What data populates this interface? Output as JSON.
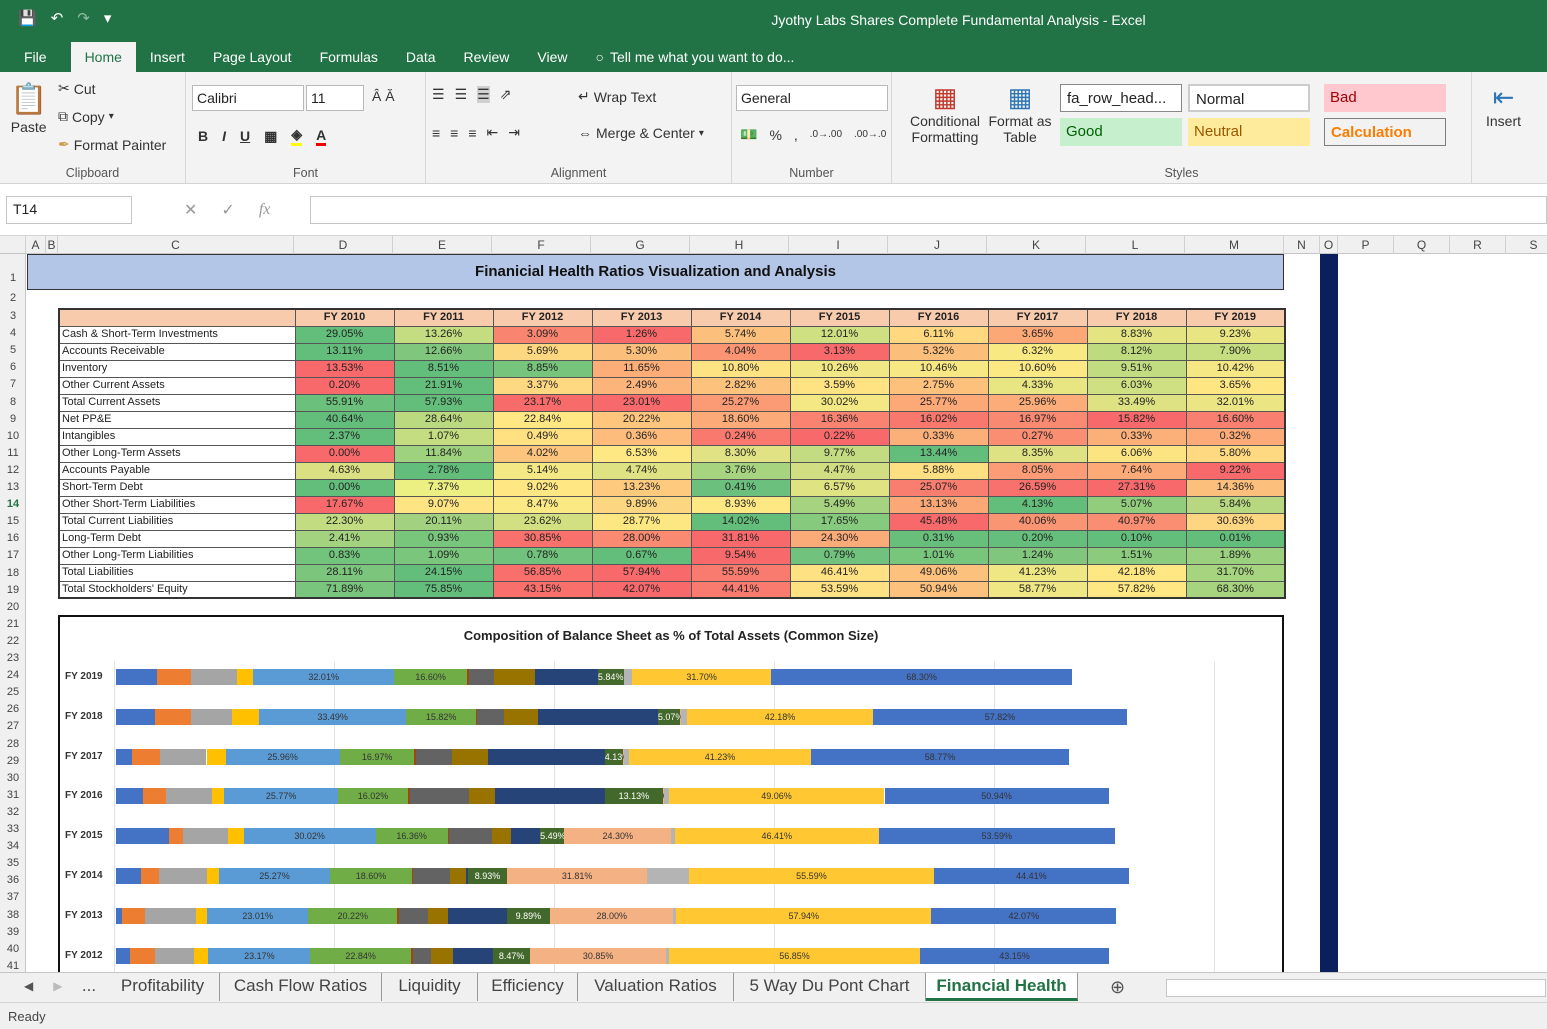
{
  "window_title": "Jyothy Labs Shares Complete Fundamental Analysis - Excel",
  "ribbon_tabs": [
    "File",
    "Home",
    "Insert",
    "Page Layout",
    "Formulas",
    "Data",
    "Review",
    "View"
  ],
  "tell_me": "Tell me what you want to do...",
  "clipboard": {
    "paste": "Paste",
    "cut": "Cut",
    "copy": "Copy",
    "format_painter": "Format Painter",
    "label": "Clipboard"
  },
  "font": {
    "name": "Calibri",
    "size": "11",
    "label": "Font"
  },
  "alignment": {
    "wrap": "Wrap Text",
    "merge": "Merge & Center",
    "label": "Alignment"
  },
  "number": {
    "format": "General",
    "label": "Number"
  },
  "styles": {
    "conditional": "Conditional Formatting",
    "format_table": "Format as Table",
    "label": "Styles",
    "cells": [
      "fa_row_head...",
      "Normal",
      "Bad",
      "Good",
      "Neutral",
      "Calculation"
    ]
  },
  "cells_group": {
    "insert": "Insert"
  },
  "name_box": "T14",
  "columns": [
    "A",
    "B",
    "C",
    "D",
    "E",
    "F",
    "G",
    "H",
    "I",
    "J",
    "K",
    "L",
    "M",
    "N",
    "O",
    "P",
    "Q",
    "R",
    "S"
  ],
  "rows": [
    "1",
    "2",
    "3",
    "4",
    "5",
    "6",
    "7",
    "8",
    "9",
    "10",
    "11",
    "12",
    "13",
    "14",
    "15",
    "16",
    "17",
    "18",
    "19",
    "20",
    "21",
    "22",
    "23",
    "24",
    "25",
    "26",
    "27",
    "28",
    "29",
    "30",
    "31",
    "32",
    "33",
    "34",
    "35",
    "36",
    "37",
    "38",
    "39",
    "40",
    "41"
  ],
  "sheet_title": "Finanicial Health Ratios Visualization and Analysis",
  "table": {
    "years": [
      "FY 2010",
      "FY 2011",
      "FY 2012",
      "FY 2013",
      "FY 2014",
      "FY 2015",
      "FY 2016",
      "FY 2017",
      "FY 2018",
      "FY 2019"
    ],
    "rows": [
      {
        "label": "Cash & Short-Term Investments",
        "values": [
          "29.05%",
          "13.26%",
          "3.09%",
          "1.26%",
          "5.74%",
          "12.01%",
          "6.11%",
          "3.65%",
          "8.83%",
          "9.23%"
        ],
        "colors": [
          "#63be7b",
          "#c3dd80",
          "#f98470",
          "#f8696b",
          "#fdc07c",
          "#cfe082",
          "#ffd880",
          "#fba776",
          "#e4e483",
          "#e9e583"
        ]
      },
      {
        "label": "Accounts Receivable",
        "values": [
          "13.11%",
          "12.66%",
          "5.69%",
          "5.30%",
          "4.04%",
          "3.13%",
          "5.32%",
          "6.32%",
          "8.12%",
          "7.90%"
        ],
        "colors": [
          "#63be7b",
          "#80c77d",
          "#fed880",
          "#fcbe7b",
          "#fa9473",
          "#f8696b",
          "#fcbf7b",
          "#f8e983",
          "#bfdb7f",
          "#c7de80"
        ]
      },
      {
        "label": "Inventory",
        "values": [
          "13.53%",
          "8.51%",
          "8.85%",
          "11.65%",
          "10.80%",
          "10.26%",
          "10.46%",
          "10.60%",
          "9.51%",
          "10.42%"
        ],
        "colors": [
          "#f8696b",
          "#63be7b",
          "#77c47c",
          "#fcad78",
          "#fee382",
          "#f1e784",
          "#f7e883",
          "#fde983",
          "#c2dc81",
          "#f5e884"
        ]
      },
      {
        "label": "Other Current Assets",
        "values": [
          "0.20%",
          "21.91%",
          "3.37%",
          "2.49%",
          "2.82%",
          "3.59%",
          "2.75%",
          "4.33%",
          "6.03%",
          "3.65%"
        ],
        "colors": [
          "#f8696b",
          "#63be7b",
          "#ffd981",
          "#fcb47a",
          "#fdc37d",
          "#ffe383",
          "#fdc17c",
          "#e8e583",
          "#cfe082",
          "#fee683"
        ]
      },
      {
        "label": "Total Current Assets",
        "values": [
          "55.91%",
          "57.93%",
          "23.17%",
          "23.01%",
          "25.27%",
          "30.02%",
          "25.77%",
          "25.96%",
          "33.49%",
          "32.01%"
        ],
        "colors": [
          "#6bc07b",
          "#63be7b",
          "#f86b6b",
          "#f8696b",
          "#fb9b75",
          "#f3e884",
          "#fca877",
          "#fcac78",
          "#dee283",
          "#ebe583"
        ]
      },
      {
        "label": "Net PP&E",
        "values": [
          "40.64%",
          "28.64%",
          "22.84%",
          "20.22%",
          "18.60%",
          "16.36%",
          "16.02%",
          "16.97%",
          "15.82%",
          "16.60%"
        ],
        "colors": [
          "#63be7b",
          "#bbda80",
          "#ffe883",
          "#fec57d",
          "#fcab78",
          "#f98270",
          "#f8786e",
          "#fa8972",
          "#f8696b",
          "#f97f70"
        ]
      },
      {
        "label": "Intangibles",
        "values": [
          "2.37%",
          "1.07%",
          "0.49%",
          "0.36%",
          "0.24%",
          "0.22%",
          "0.33%",
          "0.27%",
          "0.33%",
          "0.32%"
        ],
        "colors": [
          "#63be7b",
          "#c4dd80",
          "#ffe182",
          "#fdbc7b",
          "#f9796e",
          "#f8696b",
          "#fbaf79",
          "#fa8e72",
          "#fbaf79",
          "#fbaa78"
        ]
      },
      {
        "label": "Other Long-Term Assets",
        "values": [
          "0.00%",
          "11.84%",
          "4.02%",
          "6.53%",
          "8.30%",
          "9.77%",
          "13.44%",
          "8.35%",
          "6.06%",
          "5.80%"
        ],
        "colors": [
          "#f8696b",
          "#9fd27f",
          "#fdc47d",
          "#fee883",
          "#e0e283",
          "#c3dc81",
          "#63be7b",
          "#dfe282",
          "#fde483",
          "#fed981"
        ]
      },
      {
        "label": "Accounts Payable",
        "values": [
          "4.63%",
          "2.78%",
          "5.14%",
          "4.74%",
          "3.76%",
          "4.47%",
          "5.88%",
          "8.05%",
          "7.64%",
          "9.22%"
        ],
        "colors": [
          "#dbe182",
          "#63be7b",
          "#f3e884",
          "#dfe282",
          "#a6d47f",
          "#d1de81",
          "#fedf81",
          "#fb9c76",
          "#fcab78",
          "#f8696b"
        ]
      },
      {
        "label": "Short-Term Debt",
        "values": [
          "0.00%",
          "7.37%",
          "9.02%",
          "13.23%",
          "0.41%",
          "6.57%",
          "25.07%",
          "26.59%",
          "27.31%",
          "14.36%"
        ],
        "colors": [
          "#63be7b",
          "#ecf083",
          "#ffe883",
          "#feca7e",
          "#6ac07c",
          "#dfe382",
          "#f97e6f",
          "#f8716c",
          "#f8696b",
          "#fdbf7c"
        ]
      },
      {
        "label": "Other Short-Term Liabilities",
        "values": [
          "17.67%",
          "9.07%",
          "8.47%",
          "9.89%",
          "8.93%",
          "5.49%",
          "13.13%",
          "4.13%",
          "5.07%",
          "5.84%"
        ],
        "colors": [
          "#f8696b",
          "#fee483",
          "#fbe983",
          "#fcd680",
          "#fde883",
          "#a5d37f",
          "#fba776",
          "#63be7b",
          "#92cd7e",
          "#b7d880"
        ]
      },
      {
        "label": "Total Current Liabilities",
        "values": [
          "22.30%",
          "20.11%",
          "23.62%",
          "28.77%",
          "14.02%",
          "17.65%",
          "45.48%",
          "40.06%",
          "40.97%",
          "30.63%"
        ],
        "colors": [
          "#c1dc81",
          "#a2d27f",
          "#d3e082",
          "#fde783",
          "#63be7b",
          "#86ca7d",
          "#f8696b",
          "#fa9573",
          "#fa8e72",
          "#fed581"
        ]
      },
      {
        "label": "Long-Term Debt",
        "values": [
          "2.41%",
          "0.93%",
          "30.85%",
          "28.00%",
          "31.81%",
          "24.30%",
          "0.31%",
          "0.20%",
          "0.10%",
          "0.01%"
        ],
        "colors": [
          "#a3d37f",
          "#78c57c",
          "#f8716c",
          "#fa8b72",
          "#f8696b",
          "#fbab78",
          "#67bf7b",
          "#65be7b",
          "#64be7b",
          "#63be7b"
        ]
      },
      {
        "label": "Other Long-Term Liabilities",
        "values": [
          "0.83%",
          "1.09%",
          "0.78%",
          "0.67%",
          "9.54%",
          "0.79%",
          "1.01%",
          "1.24%",
          "1.51%",
          "1.89%"
        ],
        "colors": [
          "#72c37c",
          "#7ac67c",
          "#70c27c",
          "#63be7b",
          "#f8696b",
          "#70c27c",
          "#78c57c",
          "#80c77d",
          "#8bcb7e",
          "#9ad07e"
        ]
      },
      {
        "label": "Total Liabilities",
        "values": [
          "28.11%",
          "24.15%",
          "56.85%",
          "57.94%",
          "55.59%",
          "46.41%",
          "49.06%",
          "41.23%",
          "42.18%",
          "31.70%"
        ],
        "colors": [
          "#7bc57d",
          "#63be7b",
          "#f86f6c",
          "#f8696b",
          "#f97a6f",
          "#fee182",
          "#fcc17c",
          "#eee784",
          "#ffe883",
          "#a7d47f"
        ]
      },
      {
        "label": "Total Stockholders' Equity",
        "values": [
          "71.89%",
          "75.85%",
          "43.15%",
          "42.07%",
          "44.41%",
          "53.59%",
          "50.94%",
          "58.77%",
          "57.82%",
          "68.30%"
        ],
        "colors": [
          "#7ac57d",
          "#63be7b",
          "#f86f6c",
          "#f8696b",
          "#f97a6f",
          "#fee182",
          "#fcc17c",
          "#eee784",
          "#ffe883",
          "#a7d47f"
        ]
      }
    ]
  },
  "chart_data": {
    "type": "bar",
    "title": "Composition of Balance Sheet as % of Total Assets (Common Size)",
    "orientation": "horizontal-stacked",
    "categories": [
      "FY 2019",
      "FY 2018",
      "FY 2017",
      "FY 2016",
      "FY 2015",
      "FY 2014",
      "FY 2013",
      "FY 2012"
    ],
    "series_colors": [
      "#4472c4",
      "#ed7d31",
      "#a5a5a5",
      "#ffc000",
      "#5b9bd5",
      "#70ad47",
      "#9e480e",
      "#636363",
      "#997300",
      "#264478",
      "#43682b",
      "#f4b183",
      "#b4b4b4",
      "#ffc832"
    ],
    "stacks": [
      [
        9.23,
        7.9,
        10.42,
        3.65,
        32.01,
        16.6,
        0.32,
        5.8,
        9.22,
        14.36,
        5.84,
        0.01,
        1.89,
        31.7,
        68.3
      ],
      [
        8.83,
        8.12,
        9.51,
        6.03,
        33.49,
        15.82,
        0.33,
        6.06,
        7.64,
        27.31,
        5.07,
        0.1,
        1.51,
        42.18,
        57.82
      ],
      [
        3.65,
        6.32,
        10.6,
        4.33,
        25.96,
        16.97,
        0.27,
        8.35,
        8.05,
        26.59,
        4.13,
        0.2,
        1.24,
        41.23,
        58.77
      ],
      [
        6.11,
        5.32,
        10.46,
        2.75,
        25.77,
        16.02,
        0.33,
        13.44,
        5.88,
        25.07,
        13.13,
        0.31,
        1.01,
        49.06,
        50.94
      ],
      [
        12.01,
        3.13,
        10.26,
        3.59,
        30.02,
        16.36,
        0.22,
        9.77,
        4.47,
        6.57,
        5.49,
        24.3,
        0.79,
        46.41,
        53.59
      ],
      [
        5.74,
        4.04,
        10.8,
        2.82,
        25.27,
        18.6,
        0.24,
        8.3,
        3.76,
        0.41,
        8.93,
        31.81,
        9.54,
        55.59,
        44.41
      ],
      [
        1.26,
        5.3,
        11.65,
        2.49,
        23.01,
        20.22,
        0.36,
        6.53,
        4.74,
        13.23,
        9.89,
        28.0,
        0.67,
        57.94,
        42.07
      ],
      [
        3.09,
        5.69,
        8.85,
        3.37,
        23.17,
        22.84,
        0.49,
        4.02,
        5.14,
        9.02,
        8.47,
        30.85,
        0.78,
        56.85,
        43.15
      ]
    ],
    "labels": [
      {
        "4": "32.01%",
        "5": "16.60%",
        "10": "5.84%",
        "11": "0.01%",
        "13": "31.70%",
        "14": "68.30%"
      },
      {
        "4": "33.49%",
        "5": "15.82%",
        "10": "5.07%",
        "11": "0.10%",
        "13": "42.18%",
        "14": "57.82%"
      },
      {
        "4": "25.96%",
        "5": "16.97%",
        "10": "4.13%",
        "11": "0.20%",
        "13": "41.23%",
        "14": "58.77%"
      },
      {
        "4": "25.77%",
        "5": "16.02%",
        "10": "13.13%",
        "11": "0.31%",
        "13": "49.06%",
        "14": "50.94%"
      },
      {
        "4": "30.02%",
        "5": "16.36%",
        "10": "5.49%",
        "11": "24.30%",
        "13": "46.41%",
        "14": "53.59%"
      },
      {
        "4": "25.27%",
        "5": "18.60%",
        "10": "8.93%",
        "11": "31.81%",
        "13": "55.59%",
        "14": "44.41%"
      },
      {
        "4": "23.01%",
        "5": "20.22%",
        "10": "9.89%",
        "11": "28.00%",
        "13": "57.94%",
        "14": "42.07%"
      },
      {
        "4": "23.17%",
        "5": "22.84%",
        "10": "8.47%",
        "11": "30.85%",
        "13": "56.85%",
        "14": "43.15%"
      }
    ]
  },
  "sheet_tabs": [
    "...",
    "Profitability",
    "Cash Flow Ratios",
    "Liquidity",
    "Efficiency",
    "Valuation Ratios",
    "5 Way Du Pont Chart",
    "Financial Health"
  ],
  "status": "Ready"
}
